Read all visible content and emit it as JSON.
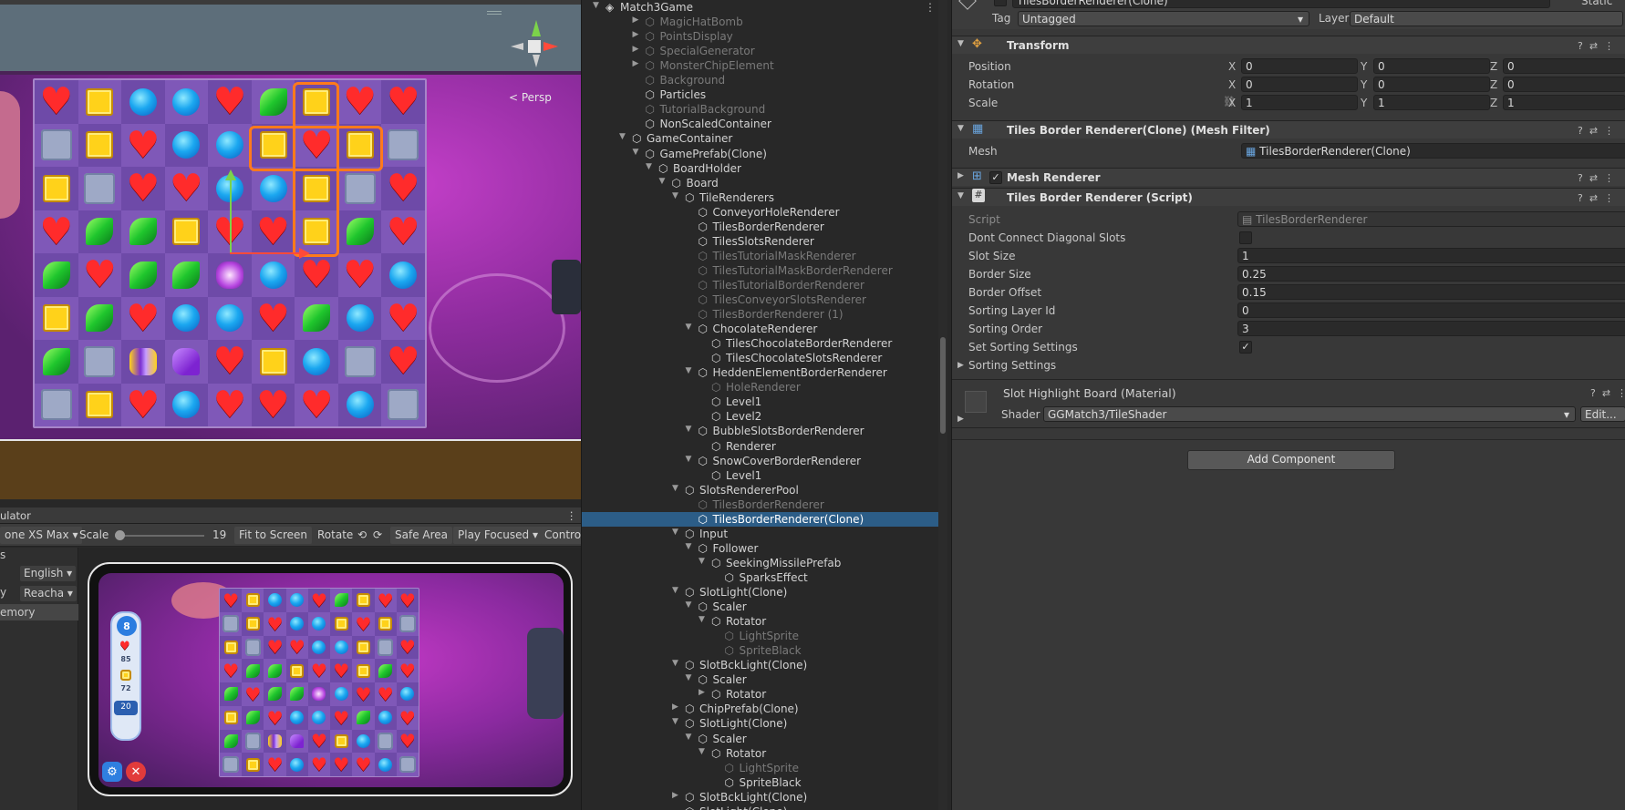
{
  "scene": {
    "persp_label": "< Persp",
    "board": [
      [
        "heart",
        "sq",
        "circ",
        "circ",
        "heart",
        "leaf",
        "sq",
        "heart",
        "heart"
      ],
      [
        "empty",
        "sq",
        "heart",
        "circ",
        "circ",
        "sq",
        "heart",
        "sq",
        "empty"
      ],
      [
        "sq",
        "empty",
        "heart",
        "heart",
        "circ",
        "circ",
        "sq",
        "empty",
        "heart"
      ],
      [
        "heart",
        "leaf",
        "leaf",
        "sq",
        "heart",
        "heart",
        "sq",
        "leaf",
        "heart"
      ],
      [
        "leaf",
        "heart",
        "leaf",
        "leaf",
        "bomb",
        "circ",
        "heart",
        "heart",
        "circ"
      ],
      [
        "sq",
        "leaf",
        "heart",
        "circ",
        "circ",
        "heart",
        "leaf",
        "circ",
        "heart"
      ],
      [
        "leaf",
        "empty",
        "roll",
        "hat",
        "heart",
        "sq",
        "circ",
        "empty",
        "heart"
      ],
      [
        "empty",
        "sq",
        "heart",
        "circ",
        "heart",
        "heart",
        "heart",
        "circ",
        "empty"
      ]
    ]
  },
  "simulator": {
    "title": "ulator",
    "device": "one XS Max",
    "scale_label": "Scale",
    "scale_value": "19",
    "scale_fraction": 0.05,
    "fit_to_screen": "Fit to Screen",
    "rotate": "Rotate",
    "safe_area": "Safe Area",
    "play_focused": "Play Focused",
    "control": "Contro",
    "left_labels": [
      "s",
      "y",
      "emory"
    ],
    "language": "English",
    "reach": "Reacha",
    "hud": {
      "moves": "8",
      "hearts": "85",
      "squares": "72",
      "stripes": "20"
    },
    "board": [
      [
        "heart",
        "sq",
        "circ",
        "circ",
        "heart",
        "leaf",
        "sq",
        "heart",
        "heart"
      ],
      [
        "empty",
        "sq",
        "heart",
        "circ",
        "circ",
        "sq",
        "heart",
        "sq",
        "empty"
      ],
      [
        "sq",
        "empty",
        "heart",
        "heart",
        "circ",
        "circ",
        "sq",
        "empty",
        "heart"
      ],
      [
        "heart",
        "leaf",
        "leaf",
        "sq",
        "heart",
        "heart",
        "sq",
        "leaf",
        "heart"
      ],
      [
        "leaf",
        "heart",
        "leaf",
        "leaf",
        "bomb",
        "circ",
        "heart",
        "heart",
        "circ"
      ],
      [
        "sq",
        "leaf",
        "heart",
        "circ",
        "circ",
        "heart",
        "leaf",
        "circ",
        "heart"
      ],
      [
        "leaf",
        "empty",
        "roll",
        "hat",
        "heart",
        "sq",
        "circ",
        "empty",
        "heart"
      ],
      [
        "empty",
        "sq",
        "heart",
        "circ",
        "heart",
        "heart",
        "heart",
        "circ",
        "empty"
      ]
    ]
  },
  "hierarchy": {
    "rows": [
      {
        "label": "Match3Game",
        "depth": 0,
        "arrow": "down",
        "icon": "unity"
      },
      {
        "label": "MagicHatBomb",
        "depth": 3,
        "arrow": "right",
        "icon": "prefab",
        "dim": true
      },
      {
        "label": "PointsDisplay",
        "depth": 3,
        "arrow": "right",
        "icon": "prefab",
        "dim": true
      },
      {
        "label": "SpecialGenerator",
        "depth": 3,
        "arrow": "right",
        "icon": "prefab",
        "dim": true
      },
      {
        "label": "MonsterChipElement",
        "depth": 3,
        "arrow": "right",
        "icon": "prefab",
        "dim": true
      },
      {
        "label": "Background",
        "depth": 3,
        "arrow": "",
        "icon": "go",
        "dim": true
      },
      {
        "label": "Particles",
        "depth": 3,
        "arrow": "",
        "icon": "go"
      },
      {
        "label": "TutorialBackground",
        "depth": 3,
        "arrow": "",
        "icon": "go",
        "dim": true
      },
      {
        "label": "NonScaledContainer",
        "depth": 3,
        "arrow": "",
        "icon": "go"
      },
      {
        "label": "GameContainer",
        "depth": 2,
        "arrow": "down",
        "icon": "go"
      },
      {
        "label": "GamePrefab(Clone)",
        "depth": 3,
        "arrow": "down",
        "icon": "go"
      },
      {
        "label": "BoardHolder",
        "depth": 4,
        "arrow": "down",
        "icon": "go"
      },
      {
        "label": "Board",
        "depth": 5,
        "arrow": "down",
        "icon": "go"
      },
      {
        "label": "TileRenderers",
        "depth": 6,
        "arrow": "down",
        "icon": "go"
      },
      {
        "label": "ConveyorHoleRenderer",
        "depth": 7,
        "arrow": "",
        "icon": "go"
      },
      {
        "label": "TilesBorderRenderer",
        "depth": 7,
        "arrow": "",
        "icon": "go"
      },
      {
        "label": "TilesSlotsRenderer",
        "depth": 7,
        "arrow": "",
        "icon": "go"
      },
      {
        "label": "TilesTutorialMaskRenderer",
        "depth": 7,
        "arrow": "",
        "icon": "go",
        "dim": true
      },
      {
        "label": "TilesTutorialMaskBorderRenderer",
        "depth": 7,
        "arrow": "",
        "icon": "go",
        "dim": true
      },
      {
        "label": "TilesTutorialBorderRenderer",
        "depth": 7,
        "arrow": "",
        "icon": "go",
        "dim": true
      },
      {
        "label": "TilesConveyorSlotsRenderer",
        "depth": 7,
        "arrow": "",
        "icon": "go",
        "dim": true
      },
      {
        "label": "TilesBorderRenderer (1)",
        "depth": 7,
        "arrow": "",
        "icon": "go",
        "dim": true
      },
      {
        "label": "ChocolateRenderer",
        "depth": 7,
        "arrow": "down",
        "icon": "go"
      },
      {
        "label": "TilesChocolateBorderRenderer",
        "depth": 8,
        "arrow": "",
        "icon": "go"
      },
      {
        "label": "TilesChocolateSlotsRenderer",
        "depth": 8,
        "arrow": "",
        "icon": "go"
      },
      {
        "label": "HeddenElementBorderRenderer",
        "depth": 7,
        "arrow": "down",
        "icon": "go"
      },
      {
        "label": "HoleRenderer",
        "depth": 8,
        "arrow": "",
        "icon": "go",
        "dim": true
      },
      {
        "label": "Level1",
        "depth": 8,
        "arrow": "",
        "icon": "go"
      },
      {
        "label": "Level2",
        "depth": 8,
        "arrow": "",
        "icon": "go"
      },
      {
        "label": "BubbleSlotsBorderRenderer",
        "depth": 7,
        "arrow": "down",
        "icon": "go"
      },
      {
        "label": "Renderer",
        "depth": 8,
        "arrow": "",
        "icon": "go"
      },
      {
        "label": "SnowCoverBorderRenderer",
        "depth": 7,
        "arrow": "down",
        "icon": "go"
      },
      {
        "label": "Level1",
        "depth": 8,
        "arrow": "",
        "icon": "go"
      },
      {
        "label": "SlotsRendererPool",
        "depth": 6,
        "arrow": "down",
        "icon": "go"
      },
      {
        "label": "TilesBorderRenderer",
        "depth": 7,
        "arrow": "",
        "icon": "go",
        "dim": true
      },
      {
        "label": "TilesBorderRenderer(Clone)",
        "depth": 7,
        "arrow": "",
        "icon": "go",
        "sel": true
      },
      {
        "label": "Input",
        "depth": 6,
        "arrow": "down",
        "icon": "go"
      },
      {
        "label": "Follower",
        "depth": 7,
        "arrow": "down",
        "icon": "go"
      },
      {
        "label": "SeekingMissilePrefab",
        "depth": 8,
        "arrow": "down",
        "icon": "go"
      },
      {
        "label": "SparksEffect",
        "depth": 9,
        "arrow": "",
        "icon": "go"
      },
      {
        "label": "SlotLight(Clone)",
        "depth": 6,
        "arrow": "down",
        "icon": "go"
      },
      {
        "label": "Scaler",
        "depth": 7,
        "arrow": "down",
        "icon": "go"
      },
      {
        "label": "Rotator",
        "depth": 8,
        "arrow": "down",
        "icon": "go"
      },
      {
        "label": "LightSprite",
        "depth": 9,
        "arrow": "",
        "icon": "go",
        "dim": true
      },
      {
        "label": "SpriteBlack",
        "depth": 9,
        "arrow": "",
        "icon": "go",
        "dim": true
      },
      {
        "label": "SlotBckLight(Clone)",
        "depth": 6,
        "arrow": "down",
        "icon": "go"
      },
      {
        "label": "Scaler",
        "depth": 7,
        "arrow": "down",
        "icon": "go"
      },
      {
        "label": "Rotator",
        "depth": 8,
        "arrow": "right",
        "icon": "go"
      },
      {
        "label": "ChipPrefab(Clone)",
        "depth": 6,
        "arrow": "right",
        "icon": "go"
      },
      {
        "label": "SlotLight(Clone)",
        "depth": 6,
        "arrow": "down",
        "icon": "go"
      },
      {
        "label": "Scaler",
        "depth": 7,
        "arrow": "down",
        "icon": "go"
      },
      {
        "label": "Rotator",
        "depth": 8,
        "arrow": "down",
        "icon": "go"
      },
      {
        "label": "LightSprite",
        "depth": 9,
        "arrow": "",
        "icon": "go",
        "dim": true
      },
      {
        "label": "SpriteBlack",
        "depth": 9,
        "arrow": "",
        "icon": "go"
      },
      {
        "label": "SlotBckLight(Clone)",
        "depth": 6,
        "arrow": "right",
        "icon": "go"
      },
      {
        "label": "SlotLight(Clone)",
        "depth": 6,
        "arrow": "",
        "icon": "go"
      }
    ]
  },
  "inspector": {
    "object_name": "TilesBorderRenderer(Clone)",
    "static_label": "Static",
    "tag_label": "Tag",
    "tag_value": "Untagged",
    "layer_label": "Layer",
    "layer_value": "Default",
    "transform": {
      "title": "Transform",
      "position_label": "Position",
      "rotation_label": "Rotation",
      "scale_label": "Scale",
      "position": {
        "x": "0",
        "y": "0",
        "z": "0"
      },
      "rotation": {
        "x": "0",
        "y": "0",
        "z": "0"
      },
      "scale": {
        "x": "1",
        "y": "1",
        "z": "1"
      },
      "x_label": "X",
      "y_label": "Y",
      "z_label": "Z"
    },
    "mesh_filter": {
      "title": "Tiles Border Renderer(Clone) (Mesh Filter)",
      "mesh_label": "Mesh",
      "mesh_value": "TilesBorderRenderer(Clone)"
    },
    "mesh_renderer": {
      "title": "Mesh Renderer",
      "enabled": true
    },
    "script_component": {
      "title": "Tiles Border Renderer (Script)",
      "script_label": "Script",
      "script_value": "TilesBorderRenderer",
      "dont_connect_label": "Dont Connect Diagonal Slots",
      "dont_connect": false,
      "slot_size_label": "Slot Size",
      "slot_size": "1",
      "border_size_label": "Border Size",
      "border_size": "0.25",
      "border_offset_label": "Border Offset",
      "border_offset": "0.15",
      "sorting_layer_label": "Sorting Layer Id",
      "sorting_layer": "0",
      "sorting_order_label": "Sorting Order",
      "sorting_order": "3",
      "set_sorting_label": "Set Sorting Settings",
      "set_sorting": true,
      "sorting_settings_label": "Sorting Settings"
    },
    "material": {
      "title": "Slot Highlight Board (Material)",
      "shader_label": "Shader",
      "shader_value": "GGMatch3/TileShader",
      "edit_label": "Edit..."
    },
    "add_component": "Add Component",
    "colors": {
      "accent": "#2c5d87",
      "panel": "#383838"
    }
  }
}
